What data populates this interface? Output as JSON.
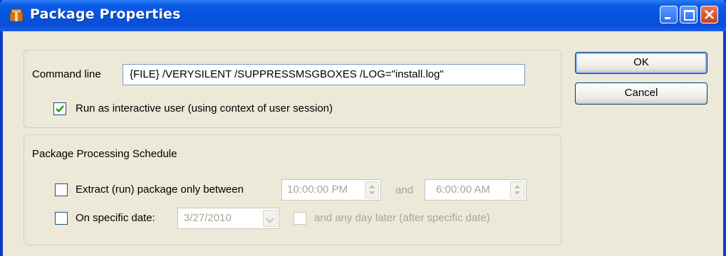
{
  "window": {
    "title": "Package Properties",
    "icon": "package-icon"
  },
  "command": {
    "label": "Command line",
    "value": "{FILE} /VERYSILENT /SUPPRESSMSGBOXES /LOG=\"install.log\"",
    "interactive_label": "Run as interactive user (using context of user session)",
    "interactive_checked": true
  },
  "schedule": {
    "heading": "Package Processing Schedule",
    "between_label": "Extract (run) package only between",
    "between_checked": false,
    "start_time": "10:00:00 PM",
    "and_label": "and",
    "end_time": "6:00:00 AM",
    "date_label": "On specific date:",
    "date_checked": false,
    "date_value": "3/27/2010",
    "later_label": "and any day later (after specific date)",
    "later_checked": false
  },
  "buttons": {
    "ok": "OK",
    "cancel": "Cancel"
  },
  "colors": {
    "titlebar": "#0454e0",
    "dialog_bg": "#ece9d8",
    "check_mark": "#21a121"
  }
}
